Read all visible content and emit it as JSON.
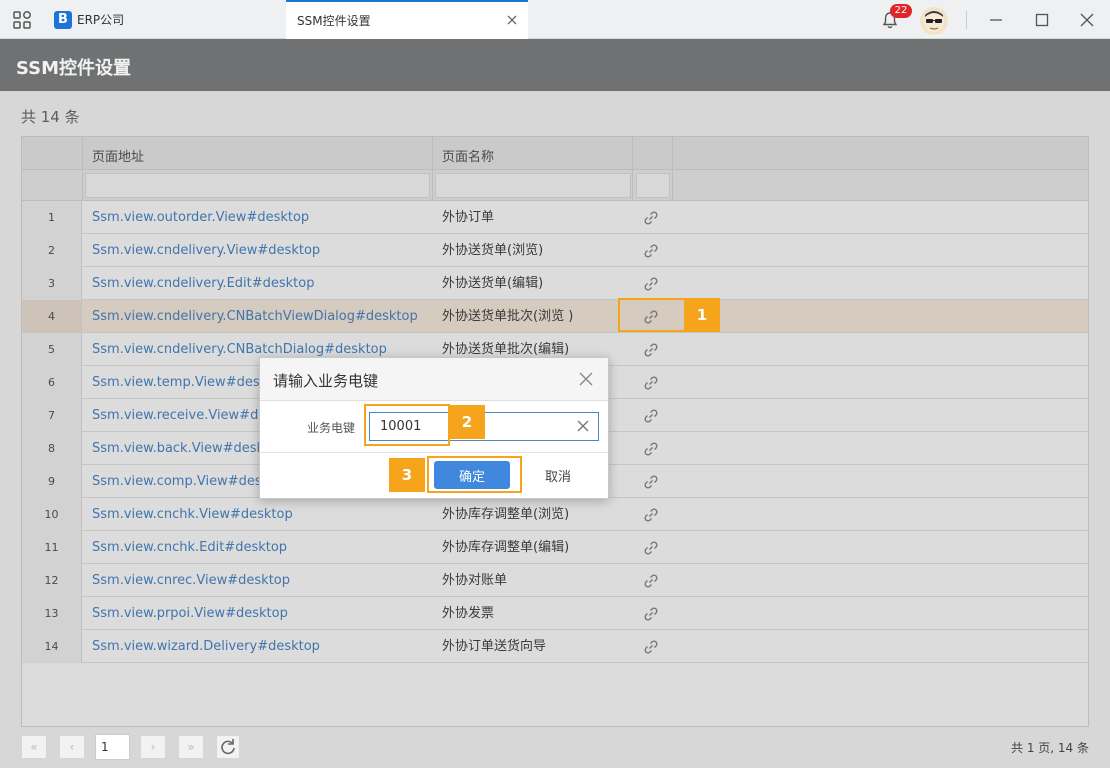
{
  "titlebar": {
    "app_name": "ERP公司",
    "logo_letter": "B",
    "active_tab": "SSM控件设置",
    "notification_count": "22"
  },
  "page": {
    "title": "SSM控件设置",
    "total_label": "共 14 条"
  },
  "grid": {
    "columns": [
      "页面地址",
      "页面名称"
    ],
    "rows": [
      {
        "n": "1",
        "addr": "Ssm.view.outorder.View#desktop",
        "name": "外协订单"
      },
      {
        "n": "2",
        "addr": "Ssm.view.cndelivery.View#desktop",
        "name": "外协送货单(浏览)"
      },
      {
        "n": "3",
        "addr": "Ssm.view.cndelivery.Edit#desktop",
        "name": "外协送货单(编辑)"
      },
      {
        "n": "4",
        "addr": "Ssm.view.cndelivery.CNBatchViewDialog#desktop",
        "name": "外协送货单批次(浏览 )"
      },
      {
        "n": "5",
        "addr": "Ssm.view.cndelivery.CNBatchDialog#desktop",
        "name": "外协送货单批次(编辑)"
      },
      {
        "n": "6",
        "addr": "Ssm.view.temp.View#desktop",
        "name": ""
      },
      {
        "n": "7",
        "addr": "Ssm.view.receive.View#desk",
        "name": ""
      },
      {
        "n": "8",
        "addr": "Ssm.view.back.View#desktop",
        "name": ""
      },
      {
        "n": "9",
        "addr": "Ssm.view.comp.View#deskto",
        "name": ""
      },
      {
        "n": "10",
        "addr": "Ssm.view.cnchk.View#desktop",
        "name": "外协库存调整单(浏览)"
      },
      {
        "n": "11",
        "addr": "Ssm.view.cnchk.Edit#desktop",
        "name": "外协库存调整单(编辑)"
      },
      {
        "n": "12",
        "addr": "Ssm.view.cnrec.View#desktop",
        "name": "外协对账单"
      },
      {
        "n": "13",
        "addr": "Ssm.view.prpoi.View#desktop",
        "name": "外协发票"
      },
      {
        "n": "14",
        "addr": "Ssm.view.wizard.Delivery#desktop",
        "name": "外协订单送货向导"
      }
    ],
    "selected_row": "4"
  },
  "dialog": {
    "title": "请输入业务电键",
    "field_label": "业务电键",
    "field_value": "10001",
    "ok_label": "确定",
    "cancel_label": "取消"
  },
  "callouts": {
    "one": "1",
    "two": "2",
    "three": "3",
    "color": "#f5a41c"
  },
  "pager": {
    "page_value": "1",
    "info": "共 1 页, 14 条"
  },
  "colors": {
    "accent": "#1e73d6",
    "header_band": "#6f7173",
    "link_text": "#4a86c5",
    "selected_row": "#f3e7da",
    "ok_button": "#3f88dd",
    "badge": "#e0262a"
  }
}
